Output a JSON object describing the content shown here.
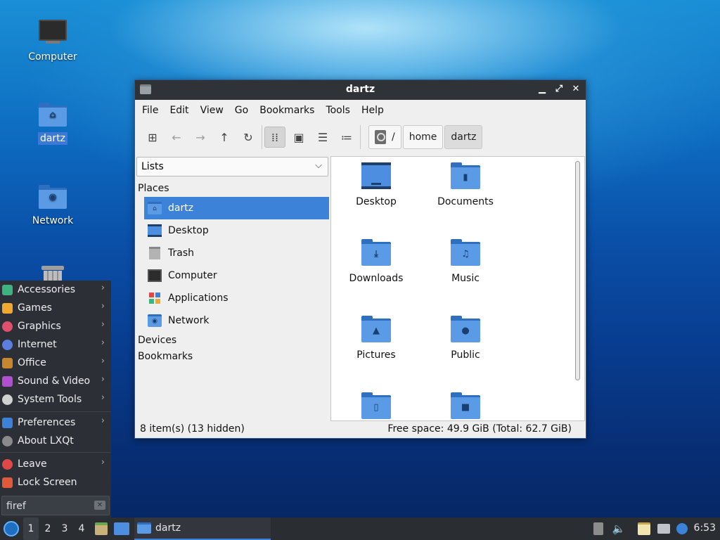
{
  "desktop": {
    "icons": [
      {
        "label": "Computer"
      },
      {
        "label": "dartz"
      },
      {
        "label": "Network"
      }
    ]
  },
  "window": {
    "title": "dartz",
    "controls": {
      "minimize": "▁",
      "maximize": "⤢",
      "close": "✕"
    },
    "menu": [
      "File",
      "Edit",
      "View",
      "Go",
      "Bookmarks",
      "Tools",
      "Help"
    ],
    "breadcrumb": [
      "/",
      "home",
      "dartz"
    ],
    "side_mode": "Lists",
    "places_header": "Places",
    "places": [
      {
        "label": "dartz"
      },
      {
        "label": "Desktop"
      },
      {
        "label": "Trash"
      },
      {
        "label": "Computer"
      },
      {
        "label": "Applications"
      },
      {
        "label": "Network"
      }
    ],
    "devices_header": "Devices",
    "bookmarks_header": "Bookmarks",
    "files": [
      {
        "label": "Desktop",
        "icon": "desktop-folder-icon"
      },
      {
        "label": "Documents",
        "icon": "documents-folder-icon"
      },
      {
        "label": "Downloads",
        "icon": "downloads-folder-icon"
      },
      {
        "label": "Music",
        "icon": "music-folder-icon"
      },
      {
        "label": "Pictures",
        "icon": "pictures-folder-icon"
      },
      {
        "label": "Public",
        "icon": "public-folder-icon"
      },
      {
        "label": "",
        "icon": "templates-folder-icon"
      },
      {
        "label": "",
        "icon": "videos-folder-icon"
      }
    ],
    "status_left": "8 item(s) (13 hidden)",
    "status_right": "Free space: 49.9 GiB (Total: 62.7 GiB)"
  },
  "app_menu": {
    "items": [
      {
        "label": "Accessories",
        "color": "#3fb37f"
      },
      {
        "label": "Games",
        "color": "#f0a830"
      },
      {
        "label": "Graphics",
        "color": "#e0506a"
      },
      {
        "label": "Internet",
        "color": "#5a7fe0"
      },
      {
        "label": "Office",
        "color": "#c8862e"
      },
      {
        "label": "Sound & Video",
        "color": "#b04fd0"
      },
      {
        "label": "System Tools",
        "color": "#d0d0d0"
      },
      {
        "label": "Preferences",
        "color": "#3c82d9"
      },
      {
        "label": "About LXQt",
        "color": "#8a8a8a"
      },
      {
        "label": "Leave",
        "color": "#e04848"
      },
      {
        "label": "Lock Screen",
        "color": "#e05a3a"
      }
    ],
    "search_value": "firef"
  },
  "taskbar": {
    "workspaces": [
      "1",
      "2",
      "3",
      "4"
    ],
    "task_title": "dartz",
    "clock": "6:53"
  },
  "colors": {
    "accent": "#3c82d9",
    "panel": "#2a2d32",
    "titlebar": "#2f3237"
  }
}
